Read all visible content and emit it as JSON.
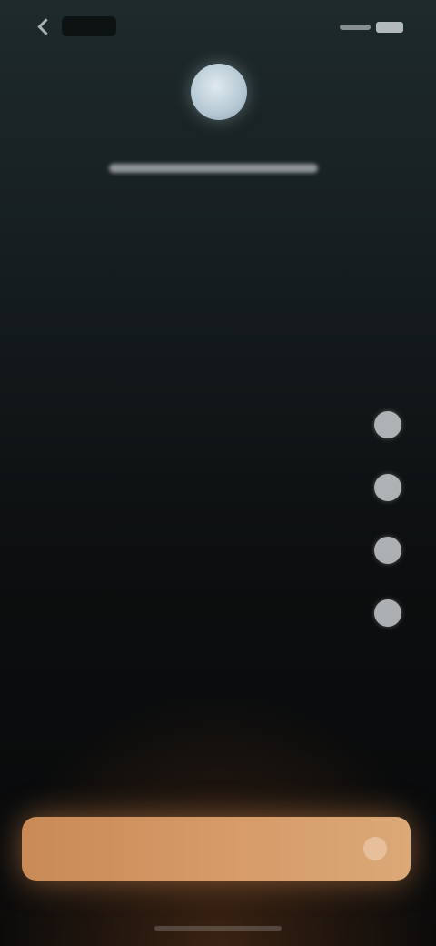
{
  "status_bar": {
    "time": "",
    "right_icons": [
      "signal-icon",
      "battery-icon"
    ]
  },
  "app": {
    "icon": "app-logo-icon",
    "name": ""
  },
  "question": {
    "title": "",
    "subtitle": ""
  },
  "options": [
    {
      "label": "",
      "selected": false
    },
    {
      "label": "",
      "selected": false
    },
    {
      "label": "",
      "selected": false
    },
    {
      "label": "",
      "selected": false
    },
    {
      "label": "",
      "selected": false
    }
  ],
  "cta": {
    "label": "",
    "icon": "arrow-right-icon"
  },
  "colors": {
    "background_top": "#1e2a2c",
    "background_bottom": "#08090a",
    "accent": "#d59a68",
    "text": "#e9eef0"
  }
}
